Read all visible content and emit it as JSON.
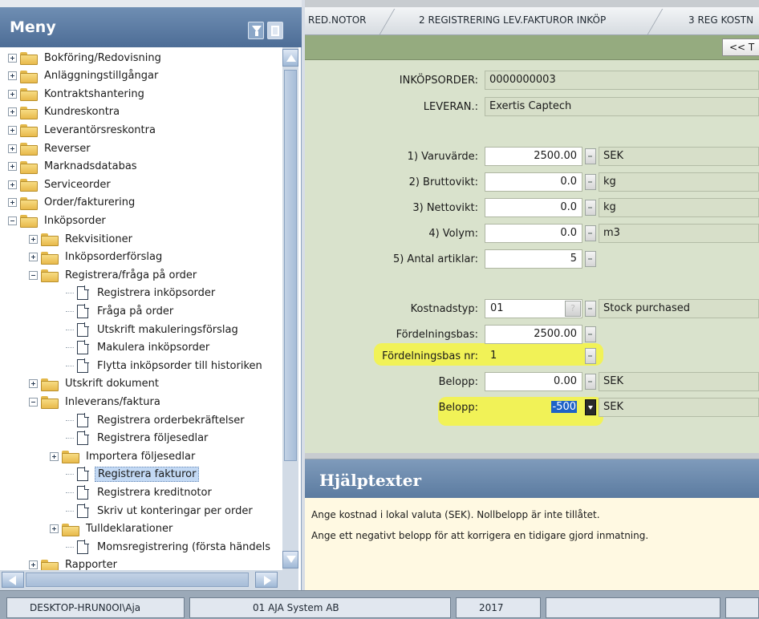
{
  "menu": {
    "title": "Meny",
    "tree": [
      {
        "label": "Bokföring/Redovisning",
        "level": 0,
        "type": "folder",
        "expander": "plus"
      },
      {
        "label": "Anläggningstillgångar",
        "level": 0,
        "type": "folder",
        "expander": "plus"
      },
      {
        "label": "Kontraktshantering",
        "level": 0,
        "type": "folder",
        "expander": "plus"
      },
      {
        "label": "Kundreskontra",
        "level": 0,
        "type": "folder",
        "expander": "plus"
      },
      {
        "label": "Leverantörsreskontra",
        "level": 0,
        "type": "folder",
        "expander": "plus"
      },
      {
        "label": "Reverser",
        "level": 0,
        "type": "folder",
        "expander": "plus"
      },
      {
        "label": "Marknadsdatabas",
        "level": 0,
        "type": "folder",
        "expander": "plus"
      },
      {
        "label": "Serviceorder",
        "level": 0,
        "type": "folder",
        "expander": "plus"
      },
      {
        "label": "Order/fakturering",
        "level": 0,
        "type": "folder",
        "expander": "plus"
      },
      {
        "label": "Inköpsorder",
        "level": 0,
        "type": "folder",
        "expander": "minus"
      },
      {
        "label": "Rekvisitioner",
        "level": 1,
        "type": "folder",
        "expander": "plus"
      },
      {
        "label": "Inköpsorderförslag",
        "level": 1,
        "type": "folder",
        "expander": "plus"
      },
      {
        "label": "Registrera/fråga på order",
        "level": 1,
        "type": "folder",
        "expander": "minus"
      },
      {
        "label": "Registrera inköpsorder",
        "level": 2,
        "type": "doc"
      },
      {
        "label": "Fråga på order",
        "level": 2,
        "type": "doc"
      },
      {
        "label": "Utskrift makuleringsförslag",
        "level": 2,
        "type": "doc"
      },
      {
        "label": "Makulera inköpsorder",
        "level": 2,
        "type": "doc"
      },
      {
        "label": "Flytta inköpsorder till historiken",
        "level": 2,
        "type": "doc"
      },
      {
        "label": "Utskrift dokument",
        "level": 1,
        "type": "folder",
        "expander": "plus"
      },
      {
        "label": "Inleverans/faktura",
        "level": 1,
        "type": "folder",
        "expander": "minus"
      },
      {
        "label": "Registrera orderbekräftelser",
        "level": 2,
        "type": "doc"
      },
      {
        "label": "Registrera följesedlar",
        "level": 2,
        "type": "doc"
      },
      {
        "label": "Importera följesedlar",
        "level": 2,
        "type": "folder",
        "expander": "plus"
      },
      {
        "label": "Registrera fakturor",
        "level": 2,
        "type": "doc",
        "selected": true
      },
      {
        "label": "Registrera kreditnotor",
        "level": 2,
        "type": "doc"
      },
      {
        "label": "Skriv ut konteringar per order",
        "level": 2,
        "type": "doc"
      },
      {
        "label": "Tulldeklarationer",
        "level": 2,
        "type": "folder",
        "expander": "plus"
      },
      {
        "label": "Momsregistrering (första händels",
        "level": 2,
        "type": "doc"
      },
      {
        "label": "Rapporter",
        "level": 1,
        "type": "folder",
        "expander": "plus"
      }
    ]
  },
  "tabs": [
    {
      "label": "RED.NOTOR"
    },
    {
      "label": "2 REGISTRERING LEV.FAKTUROR INKÖP"
    },
    {
      "label": "3 REG KOSTN"
    }
  ],
  "toolbar": {
    "back_label": "<< T"
  },
  "form": {
    "inkopsorder_label": "INKÖPSORDER:",
    "inkopsorder_value": "0000000003",
    "leveran_label": "LEVERAN.:",
    "leveran_value": "Exertis Captech",
    "varuvarde_label": "1) Varuvärde:",
    "varuvarde_value": "2500.00",
    "varuvarde_unit": "SEK",
    "bruttovikt_label": "2) Bruttovikt:",
    "bruttovikt_value": "0.0",
    "bruttovikt_unit": "kg",
    "nettovikt_label": "3) Nettovikt:",
    "nettovikt_value": "0.0",
    "nettovikt_unit": "kg",
    "volym_label": "4) Volym:",
    "volym_value": "0.0",
    "volym_unit": "m3",
    "antal_label": "5) Antal artiklar:",
    "antal_value": "5",
    "kostnadstyp_label": "Kostnadstyp:",
    "kostnadstyp_value": "01",
    "kostnadstyp_q": "?",
    "kostnadstyp_desc": "Stock purchased",
    "fordelningsbas_label": "Fördelningsbas:",
    "fordelningsbas_value": "2500.00",
    "fordelningsbas_nr_label": "Fördelningsbas nr:",
    "fordelningsbas_nr_value": "1",
    "belopp1_label": "Belopp:",
    "belopp1_value": "0.00",
    "belopp1_unit": "SEK",
    "belopp2_label": "Belopp:",
    "belopp2_value": "-500",
    "belopp2_unit": "SEK"
  },
  "help": {
    "title": "Hjälptexter",
    "line1": "Ange kostnad i lokal valuta (SEK). Nollbelopp är inte tillåtet.",
    "line2": "Ange ett negativt belopp för att korrigera en tidigare gjord inmatning."
  },
  "status": {
    "host": "DESKTOP-HRUN0OI\\Aja",
    "company": "01 AJA System AB",
    "year": "2017"
  },
  "colors": {
    "menu_header": "#5b7ba0",
    "form_bg": "#d9e2cc",
    "toolbar_bg": "#95ab7f",
    "highlight": "#f3f44a",
    "help_bg": "#fff9e2"
  }
}
